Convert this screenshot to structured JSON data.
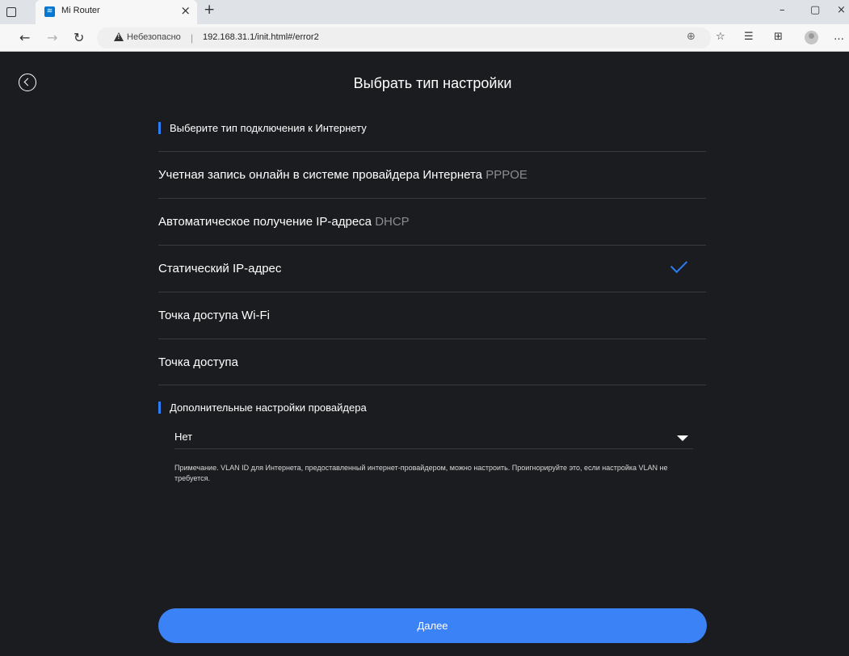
{
  "browser": {
    "tab_title": "Mi Router",
    "tab_favicon": "wifi-icon",
    "new_tab_label": "+",
    "security_label": "Небезопасно",
    "url": "192.168.31.1/init.html#/error2"
  },
  "page": {
    "title": "Выбрать тип настройки",
    "section_connection": "Выберите тип подключения к Интернету",
    "options": [
      {
        "label": "Учетная запись онлайн в системе провайдера Интернета",
        "tag": "PPPOE",
        "selected": false
      },
      {
        "label": "Автоматическое получение IP-адреса",
        "tag": "DHCP",
        "selected": false
      },
      {
        "label": "Статический IP-адрес",
        "tag": "",
        "selected": true
      },
      {
        "label": "Точка доступа Wi-Fi",
        "tag": "",
        "selected": false
      },
      {
        "label": "Точка доступа",
        "tag": "",
        "selected": false
      }
    ],
    "section_advanced": "Дополнительные настройки провайдера",
    "advanced_value": "Нет",
    "note": "Примечание. VLAN ID для Интернета, предоставленный интернет-провайдером, можно настроить. Проигнорируйте это, если настройка VLAN не требуется.",
    "next_button": "Далее"
  },
  "colors": {
    "accent": "#3b82f6",
    "background": "#1b1c1f",
    "tag_gray": "#8b8c90"
  }
}
